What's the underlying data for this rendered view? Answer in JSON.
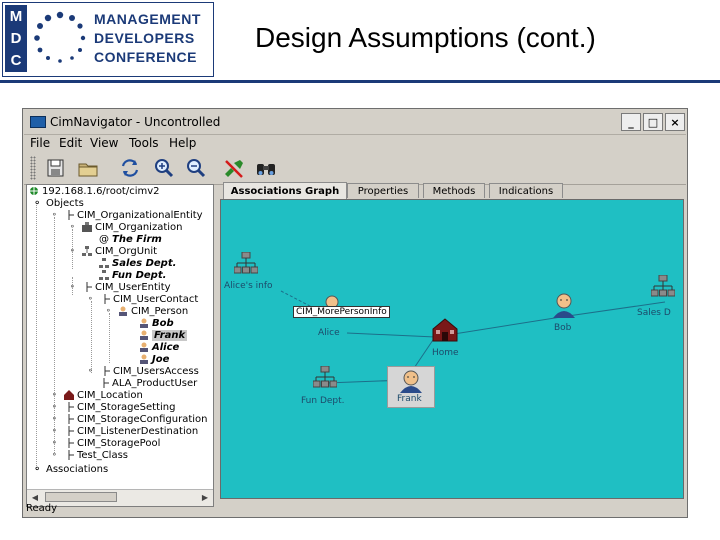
{
  "slide": {
    "logo_letters": [
      "M",
      "D",
      "C"
    ],
    "logo_words": [
      "MANAGEMENT",
      "DEVELOPERS",
      "CONFERENCE"
    ],
    "title": "Design Assumptions (cont.)"
  },
  "window": {
    "title": "CimNavigator - Uncontrolled",
    "buttons": {
      "minimize": "_",
      "maximize": "□",
      "close": "×"
    }
  },
  "menu": [
    "File",
    "Edit",
    "View",
    "Tools",
    "Help"
  ],
  "toolbar": {
    "icons": [
      "save-icon",
      "open-folder-icon",
      "refresh-icon",
      "zoom-in-icon",
      "zoom-out-icon",
      "disconnect-icon",
      "binoculars-icon"
    ]
  },
  "tree": {
    "rows": [
      {
        "label": "192.168.1.6/root/cimv2",
        "style": "normal"
      },
      {
        "label": "Objects",
        "style": "normal"
      },
      {
        "label": "CIM_OrganizationalEntity",
        "style": "normal"
      },
      {
        "label": "CIM_Organization",
        "style": "normal"
      },
      {
        "label": "The Firm",
        "style": "bold-italic"
      },
      {
        "label": "CIM_OrgUnit",
        "style": "normal"
      },
      {
        "label": "Sales Dept.",
        "style": "bold-italic"
      },
      {
        "label": "Fun Dept.",
        "style": "bold-italic"
      },
      {
        "label": "CIM_UserEntity",
        "style": "normal"
      },
      {
        "label": "CIM_UserContact",
        "style": "normal"
      },
      {
        "label": "CIM_Person",
        "style": "normal"
      },
      {
        "label": "Bob",
        "style": "bold-italic"
      },
      {
        "label": "Frank",
        "style": "bold-italic"
      },
      {
        "label": "Alice",
        "style": "bold-italic"
      },
      {
        "label": "Joe",
        "style": "bold-italic"
      },
      {
        "label": "CIM_UsersAccess",
        "style": "normal"
      },
      {
        "label": "ALA_ProductUser",
        "style": "normal"
      },
      {
        "label": "CIM_Location",
        "style": "normal"
      },
      {
        "label": "CIM_StorageSetting",
        "style": "normal"
      },
      {
        "label": "CIM_StorageConfiguration",
        "style": "normal"
      },
      {
        "label": "CIM_ListenerDestination",
        "style": "normal"
      },
      {
        "label": "CIM_StoragePool",
        "style": "normal"
      },
      {
        "label": "Test_Class",
        "style": "normal"
      },
      {
        "label": "Associations",
        "style": "normal"
      }
    ]
  },
  "tabs": [
    "Associations Graph",
    "Properties",
    "Methods",
    "Indications"
  ],
  "active_tab": "Associations Graph",
  "graph": {
    "background": "#1fbfc3",
    "nodes": {
      "alices_info": "Alice's info",
      "info_box": "CIM_MorePersonInfo",
      "alice": "Alice",
      "home": "Home",
      "bob": "Bob",
      "sales": "Sales D",
      "fun_dept": "Fun Dept.",
      "frank": "Frank"
    }
  },
  "status": "Ready"
}
